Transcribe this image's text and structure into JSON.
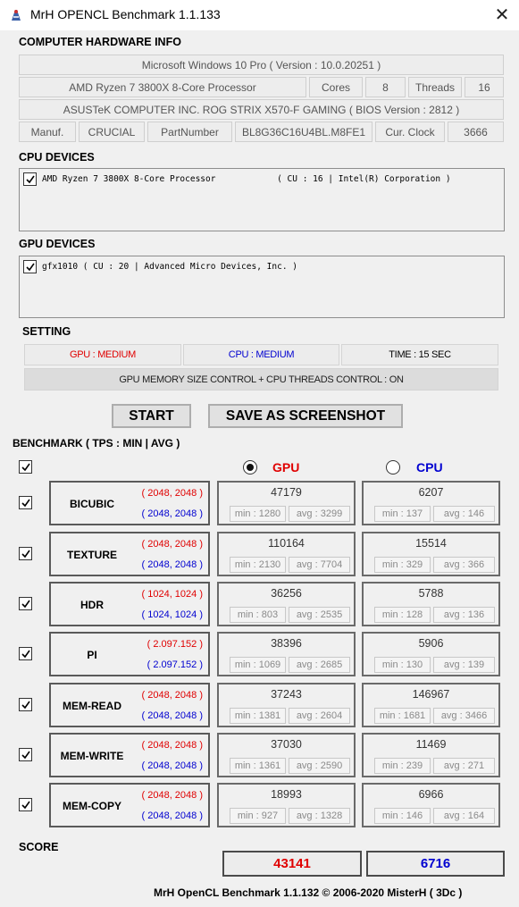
{
  "window": {
    "title": "MrH OPENCL Benchmark 1.1.133"
  },
  "hardware": {
    "heading": "COMPUTER HARDWARE INFO",
    "os": "Microsoft Windows 10 Pro ( Version : 10.0.20251 )",
    "cpu_name": "AMD Ryzen 7 3800X 8-Core Processor",
    "cores_label": "Cores",
    "cores_value": "8",
    "threads_label": "Threads",
    "threads_value": "16",
    "board": "ASUSTeK COMPUTER INC. ROG STRIX X570-F GAMING ( BIOS Version : 2812 )",
    "manuf_label": "Manuf.",
    "manuf_value": "CRUCIAL",
    "part_label": "PartNumber",
    "part_value": "BL8G36C16U4BL.M8FE1",
    "clock_label": "Cur. Clock",
    "clock_value": "3666"
  },
  "cpu_devices": {
    "heading": "CPU DEVICES",
    "items": [
      "AMD Ryzen 7 3800X 8-Core Processor            ( CU : 16 | Intel(R) Corporation )"
    ]
  },
  "gpu_devices": {
    "heading": "GPU DEVICES",
    "items": [
      "gfx1010 ( CU : 20 | Advanced Micro Devices, Inc. )"
    ]
  },
  "setting": {
    "heading": "SETTING",
    "gpu": "GPU : MEDIUM",
    "cpu": "CPU : MEDIUM",
    "time": "TIME : 15 SEC",
    "memory": "GPU MEMORY SIZE CONTROL + CPU THREADS CONTROL : ON"
  },
  "buttons": {
    "start": "START",
    "screenshot": "SAVE AS SCREENSHOT"
  },
  "benchmark": {
    "heading": "BENCHMARK ( TPS : MIN | AVG )",
    "gpu_label": "GPU",
    "cpu_label": "CPU",
    "selected": "GPU",
    "rows": [
      {
        "name": "BICUBIC",
        "gpu_size": "( 2048, 2048 )",
        "cpu_size": "( 2048, 2048 )",
        "gpu_score": "47179",
        "gpu_min": "min : 1280",
        "gpu_avg": "avg : 3299",
        "cpu_score": "6207",
        "cpu_min": "min : 137",
        "cpu_avg": "avg : 146"
      },
      {
        "name": "TEXTURE",
        "gpu_size": "( 2048, 2048 )",
        "cpu_size": "( 2048, 2048 )",
        "gpu_score": "110164",
        "gpu_min": "min : 2130",
        "gpu_avg": "avg : 7704",
        "cpu_score": "15514",
        "cpu_min": "min : 329",
        "cpu_avg": "avg : 366"
      },
      {
        "name": "HDR",
        "gpu_size": "( 1024, 1024 )",
        "cpu_size": "( 1024, 1024 )",
        "gpu_score": "36256",
        "gpu_min": "min : 803",
        "gpu_avg": "avg : 2535",
        "cpu_score": "5788",
        "cpu_min": "min : 128",
        "cpu_avg": "avg : 136"
      },
      {
        "name": "PI",
        "gpu_size": "( 2.097.152 )",
        "cpu_size": "( 2.097.152 )",
        "gpu_score": "38396",
        "gpu_min": "min : 1069",
        "gpu_avg": "avg : 2685",
        "cpu_score": "5906",
        "cpu_min": "min : 130",
        "cpu_avg": "avg : 139"
      },
      {
        "name": "MEM-READ",
        "gpu_size": "( 2048, 2048 )",
        "cpu_size": "( 2048, 2048 )",
        "gpu_score": "37243",
        "gpu_min": "min : 1381",
        "gpu_avg": "avg : 2604",
        "cpu_score": "146967",
        "cpu_min": "min : 1681",
        "cpu_avg": "avg : 3466"
      },
      {
        "name": "MEM-WRITE",
        "gpu_size": "( 2048, 2048 )",
        "cpu_size": "( 2048, 2048 )",
        "gpu_score": "37030",
        "gpu_min": "min : 1361",
        "gpu_avg": "avg : 2590",
        "cpu_score": "11469",
        "cpu_min": "min : 239",
        "cpu_avg": "avg : 271"
      },
      {
        "name": "MEM-COPY",
        "gpu_size": "( 2048, 2048 )",
        "cpu_size": "( 2048, 2048 )",
        "gpu_score": "18993",
        "gpu_min": "min : 927",
        "gpu_avg": "avg : 1328",
        "cpu_score": "6966",
        "cpu_min": "min : 146",
        "cpu_avg": "avg : 164"
      }
    ]
  },
  "score": {
    "heading": "SCORE",
    "gpu": "43141",
    "cpu": "6716"
  },
  "footer": "MrH OpenCL Benchmark 1.1.132  ©  2006-2020 MisterH ( 3Dc )",
  "colors": {
    "gpu": "#e00000",
    "cpu": "#0000d0",
    "background": "#f0f0f0"
  }
}
